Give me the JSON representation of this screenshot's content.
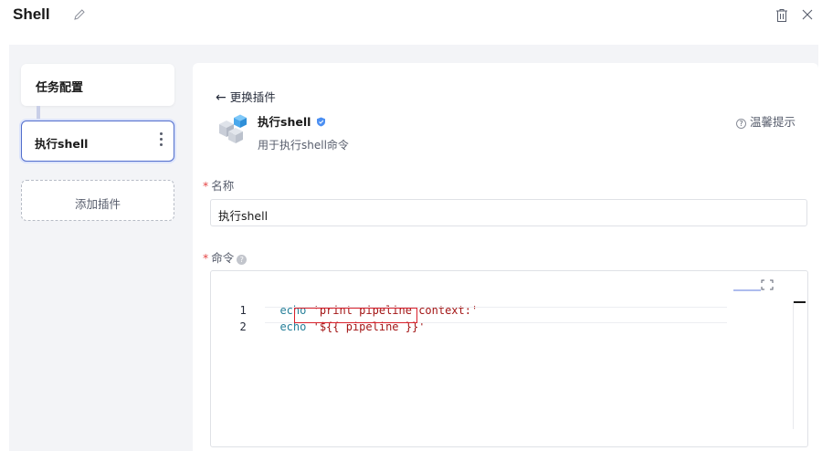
{
  "header": {
    "title": "Shell",
    "edit_icon": "pencil-icon",
    "delete_icon": "trash-icon",
    "close_icon": "close-icon"
  },
  "sidebar": {
    "stage": {
      "label": "任务配置"
    },
    "plugin": {
      "label": "执行shell",
      "menu_icon": "kebab-menu-icon"
    },
    "add_plugin": {
      "label": "添加插件"
    }
  },
  "panel": {
    "back_label": "更换插件",
    "plugin": {
      "icon": "plugin-cubes-icon",
      "name": "执行shell",
      "verified_icon": "verified-badge-icon",
      "description": "用于执行shell命令"
    },
    "tips_label": "温馨提示",
    "name_field": {
      "label": "名称",
      "required": true,
      "value": "执行shell"
    },
    "command_field": {
      "label": "命令",
      "required": true,
      "help_icon": "question-icon",
      "expand_icon": "fullscreen-icon",
      "lines": [
        {
          "number": "1",
          "keyword": "echo",
          "string": "'print pipeline context:'"
        },
        {
          "number": "2",
          "keyword": "echo",
          "string": "'${{ pipeline }}'"
        }
      ]
    }
  },
  "colors": {
    "accent": "#526ecc",
    "required": "#e54545",
    "highlight": "#d9202b",
    "keyword": "#267f99",
    "string": "#a31515"
  }
}
